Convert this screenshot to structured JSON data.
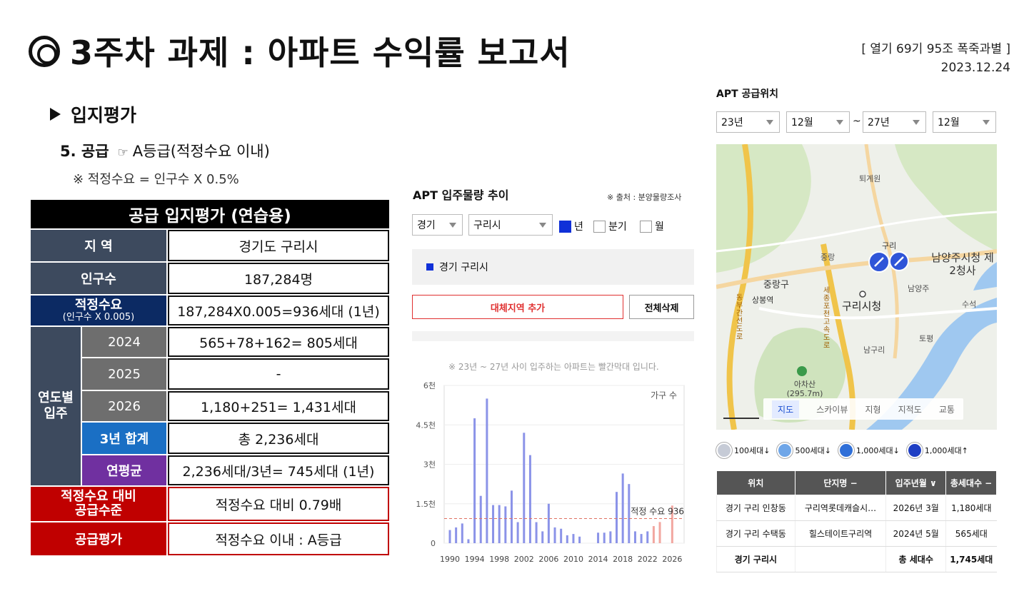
{
  "header": {
    "title": "3주차 과제 : 아파트 수익률 보고서",
    "meta_line1": "[ 열기 69기 95조 폭죽과별 ]",
    "meta_line2": "2023.12.24"
  },
  "section": {
    "heading": "입지평가",
    "sub_number": "5. 공급",
    "sub_pointer": "☞",
    "sub_grade": "A등급(적정수요 이내)",
    "note": "※ 적정수요 = 인구수 X 0.5%"
  },
  "supply_table": {
    "title": "공급 입지평가 (연습용)",
    "region_label": "지 역",
    "region_value": "경기도 구리시",
    "population_label": "인구수",
    "population_value": "187,284명",
    "demand_label": "적정수요",
    "demand_sublabel": "(인구수 X 0.005)",
    "demand_value": "187,284X0.005=936세대 (1년)",
    "yearly_label_1": "연도별",
    "yearly_label_2": "입주",
    "year_2024_label": "2024",
    "year_2024_value": "565+78+162= 805세대",
    "year_2025_label": "2025",
    "year_2025_value": "-",
    "year_2026_label": "2026",
    "year_2026_value": "1,180+251= 1,431세대",
    "sum_label": "3년 합계",
    "sum_value": "총 2,236세대",
    "avg_label": "연평균",
    "avg_value": "2,236세대/3년= 745세대 (1년)",
    "ratio_label_1": "적정수요 대비",
    "ratio_label_2": "공급수준",
    "ratio_value": "적정수요 대비 0.79배",
    "eval_label": "공급평가",
    "eval_value": "적정수요 이내 : A등급"
  },
  "supply_panel": {
    "title": "APT 입주물량 추이",
    "source": "※ 출처 : 분양물량조사",
    "province": "경기",
    "city": "구리시",
    "opt_year": "년",
    "opt_quarter": "분기",
    "opt_month": "월",
    "selected_region": "경기 구리시",
    "btn_add": "대체지역 추가",
    "btn_delete": "전체삭제",
    "chart_note": "※ 23년 ~ 27년 사이 입주하는 아파트는 빨간막대 입니다."
  },
  "chart_data": {
    "type": "bar",
    "ylabel": "가구 수",
    "y_tick_labels": [
      "0",
      "1.5천",
      "3천",
      "4.5천",
      "6천"
    ],
    "y_ticks": [
      0,
      1500,
      3000,
      4500,
      6000
    ],
    "ylim": [
      0,
      6000
    ],
    "x_tick_labels": [
      "1990",
      "1994",
      "1998",
      "2002",
      "2006",
      "2010",
      "2014",
      "2018",
      "2022",
      "2026"
    ],
    "x": [
      1990,
      1991,
      1992,
      1993,
      1994,
      1995,
      1996,
      1997,
      1998,
      1999,
      2000,
      2001,
      2002,
      2003,
      2004,
      2005,
      2006,
      2007,
      2008,
      2009,
      2010,
      2011,
      2012,
      2013,
      2014,
      2015,
      2016,
      2017,
      2018,
      2019,
      2020,
      2021,
      2022,
      2023,
      2024,
      2025,
      2026,
      2027
    ],
    "values": [
      500,
      600,
      750,
      150,
      4750,
      1800,
      5500,
      1450,
      1450,
      1400,
      2000,
      800,
      4200,
      3350,
      800,
      450,
      1500,
      600,
      550,
      300,
      350,
      250,
      0,
      0,
      400,
      400,
      450,
      1950,
      2650,
      2250,
      450,
      350,
      450,
      650,
      805,
      0,
      1431,
      0
    ],
    "highlight_from": 2023,
    "highlight_to": 2027,
    "reference_value": 936,
    "reference_label": "적정 수요 936",
    "colors": {
      "bar": "#8b93e8",
      "highlight": "#f2a7a0",
      "reference": "#e07060"
    }
  },
  "map_panel": {
    "title": "APT 공급위치",
    "from_year": "23년",
    "from_month": "12월",
    "tilde": "~",
    "to_year": "27년",
    "to_month": "12월",
    "places": {
      "toegyewon": "퇴계원",
      "guri_station": "구리",
      "jungrang": "중랑",
      "namyangju_office": "남양주시청 제2청사",
      "jungrang_gu": "중랑구",
      "sangbong": "상봉역",
      "guri_city_hall": "구리시청",
      "namyangju": "남양주",
      "suseok": "수석",
      "topyeong": "토평",
      "achasan": "아차산 (295.7m)",
      "south_guri": "남구리",
      "road_1": "세종포천고속도로",
      "road_2": "동부간선도로"
    },
    "map_tabs": [
      "지도",
      "스카이뷰",
      "지형",
      "지적도",
      "교통"
    ],
    "legend": [
      "100세대↓",
      "500세대↓",
      "1,000세대↓",
      "1,000세대↑"
    ],
    "legend_colors": [
      "#c6cbd6",
      "#6fa6e8",
      "#2f6fd8",
      "#1f3fc4"
    ],
    "table_headers": [
      "위치",
      "단지명 −",
      "입주년월 ∨",
      "총세대수 −"
    ],
    "rows": [
      {
        "loc": "경기 구리 인창동",
        "name": "구리역롯데캐슬시…",
        "date": "2026년 3월",
        "units": "1,180세대"
      },
      {
        "loc": "경기 구리 수택동",
        "name": "힐스테이트구리역",
        "date": "2024년 5월",
        "units": "565세대"
      }
    ],
    "total_loc": "경기 구리시",
    "total_label": "총 세대수",
    "total_units": "1,745세대"
  }
}
